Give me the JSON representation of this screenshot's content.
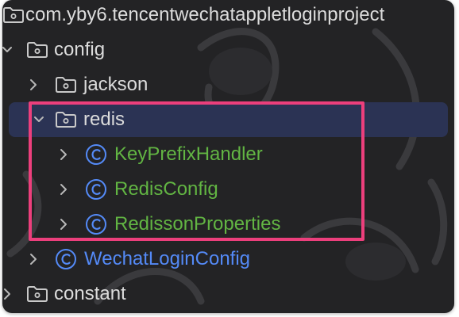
{
  "tree": {
    "items": [
      {
        "label": "com.yby6.tencentwechatappletloginproject",
        "icon": "folder-icon"
      },
      {
        "label": "config",
        "icon": "folder-icon",
        "expanded": true
      },
      {
        "label": "jackson",
        "icon": "folder-icon",
        "expanded": false
      },
      {
        "label": "redis",
        "icon": "folder-icon",
        "expanded": true,
        "selected": true
      },
      {
        "label": "KeyPrefixHandler",
        "icon": "class-icon",
        "expanded": false
      },
      {
        "label": "RedisConfig",
        "icon": "class-icon",
        "expanded": false
      },
      {
        "label": "RedissonProperties",
        "icon": "class-icon",
        "expanded": false
      },
      {
        "label": "WechatLoginConfig",
        "icon": "class-icon",
        "expanded": false
      },
      {
        "label": "constant",
        "icon": "folder-icon",
        "expanded": false
      }
    ]
  },
  "colors": {
    "background": "#232325",
    "selection": "#2b3354",
    "text": "#dcdcdc",
    "class_green": "#62b543",
    "class_blue": "#548af7",
    "annotation_box": "#ec3f7c"
  }
}
